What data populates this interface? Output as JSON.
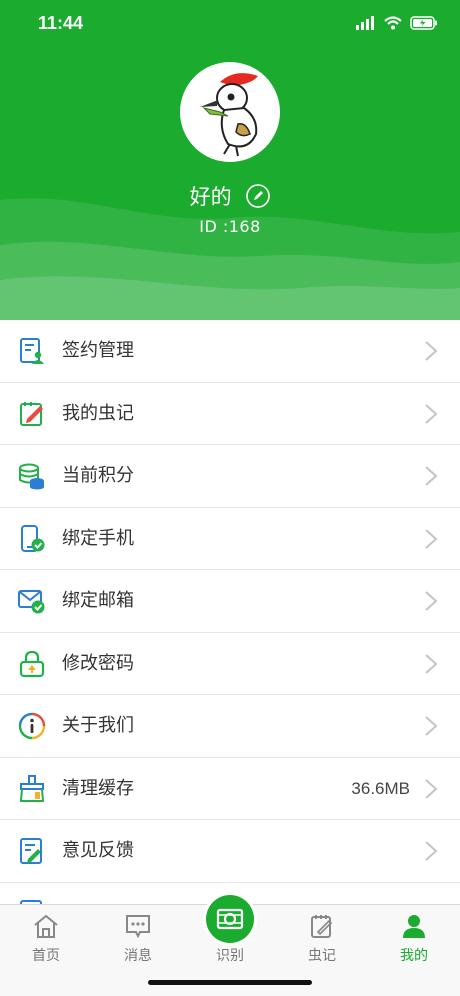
{
  "status_bar": {
    "time": "11:44"
  },
  "profile": {
    "nickname": "好的",
    "user_id": "ID :168"
  },
  "menu": {
    "items": [
      {
        "label": "签约管理",
        "icon": "contract-icon",
        "value": ""
      },
      {
        "label": "我的虫记",
        "icon": "notebook-pen-icon",
        "value": ""
      },
      {
        "label": "当前积分",
        "icon": "coins-icon",
        "value": ""
      },
      {
        "label": "绑定手机",
        "icon": "phone-check-icon",
        "value": ""
      },
      {
        "label": "绑定邮箱",
        "icon": "mail-check-icon",
        "value": ""
      },
      {
        "label": "修改密码",
        "icon": "lock-icon",
        "value": ""
      },
      {
        "label": "关于我们",
        "icon": "info-icon",
        "value": ""
      },
      {
        "label": "清理缓存",
        "icon": "broom-icon",
        "value": "36.6MB"
      },
      {
        "label": "意见反馈",
        "icon": "feedback-icon",
        "value": ""
      }
    ]
  },
  "tabbar": {
    "tabs": [
      {
        "label": "首页",
        "icon": "home-icon",
        "active": false
      },
      {
        "label": "消息",
        "icon": "message-icon",
        "active": false
      },
      {
        "label": "识别",
        "icon": "camera-icon",
        "active": false
      },
      {
        "label": "虫记",
        "icon": "notebook-icon",
        "active": false
      },
      {
        "label": "我的",
        "icon": "user-icon",
        "active": true
      }
    ]
  },
  "colors": {
    "primary": "#1aab2f",
    "icon_blue": "#2a7fd4",
    "icon_green": "#22b04a"
  }
}
